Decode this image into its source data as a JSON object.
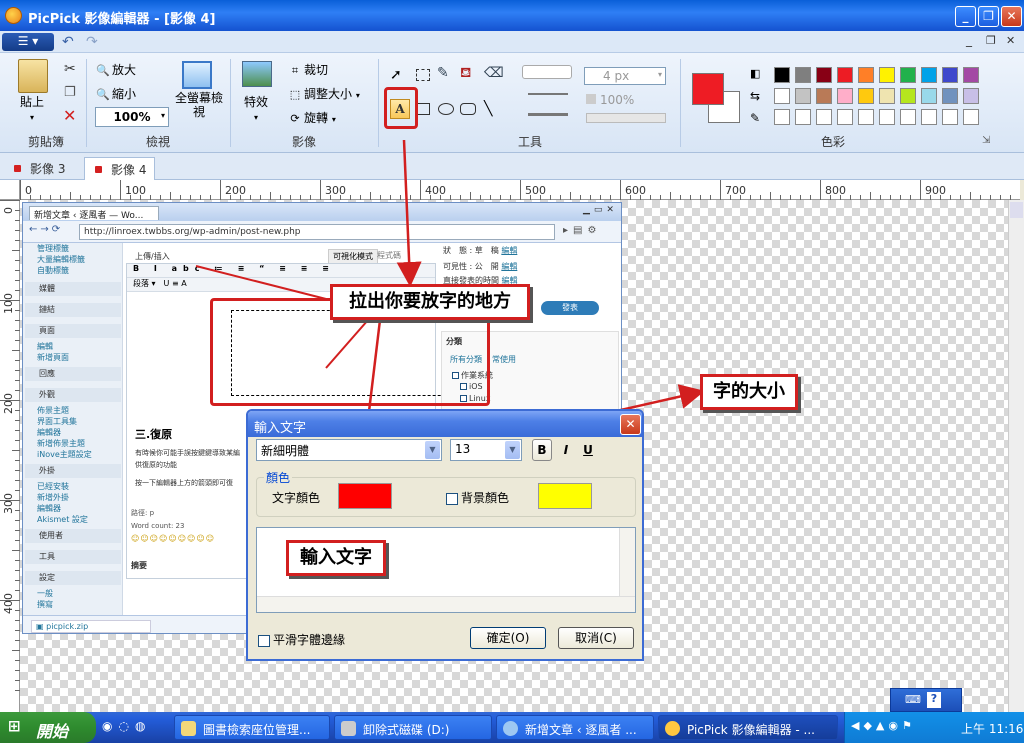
{
  "window": {
    "title": "PicPick 影像編輯器 - [影像 4]"
  },
  "ribbon": {
    "clipboard": {
      "paste": "貼上",
      "label": "剪貼簿"
    },
    "view": {
      "zoom_in": "放大",
      "zoom_out": "縮小",
      "zoom_value": "100%",
      "fullscreen": "全螢幕檢視",
      "label": "檢視"
    },
    "image": {
      "effects": "特效",
      "crop": "裁切",
      "resize": "調整大小",
      "rotate": "旋轉",
      "label": "影像"
    },
    "tools": {
      "label": "工具",
      "text_tool_letter": "A",
      "line_width": "4 px",
      "opacity": "100%"
    },
    "colors": {
      "label": "色彩",
      "primary": "#ee1c24",
      "secondary": "#ffffff",
      "palette_row1": [
        "#000000",
        "#7f7f7f",
        "#880015",
        "#ed1c24",
        "#ff7f27",
        "#fff200",
        "#22b14c",
        "#00a2e8",
        "#3f48cc",
        "#a349a4"
      ],
      "palette_row2": [
        "#ffffff",
        "#c3c3c3",
        "#b97a57",
        "#ffaec9",
        "#ffc90e",
        "#efe4b0",
        "#b5e61d",
        "#99d9ea",
        "#7092be",
        "#c8bfe7"
      ]
    }
  },
  "tabs": [
    {
      "label": "影像 3"
    },
    {
      "label": "影像 4"
    }
  ],
  "ruler": {
    "h": [
      "0",
      "100",
      "200",
      "300",
      "400",
      "500",
      "600",
      "700",
      "800",
      "900"
    ],
    "v": [
      "0",
      "100",
      "200",
      "300",
      "400"
    ]
  },
  "screenshot": {
    "browser_tab": "新增文章 ‹ 逐風者 — Wo...",
    "url": "http://linroex.twbbs.org/wp-admin/post-new.php",
    "upload": "上傳/插入",
    "visual_tab": "可視化模式",
    "html_tab": "程式碼",
    "format": "段落",
    "side_top": [
      "管理標籤",
      "大量編輯標籤",
      "自動標籤"
    ],
    "side_sections": [
      {
        "head": "媒體",
        "items": []
      },
      {
        "head": "鏈結",
        "items": []
      },
      {
        "head": "頁面",
        "items": [
          "編輯",
          "新增頁面"
        ]
      },
      {
        "head": "回應",
        "items": []
      },
      {
        "head": "外觀",
        "items": [
          "佈景主題",
          "界面工具集",
          "編輯器",
          "新增佈景主題",
          "iNove主題設定"
        ]
      },
      {
        "head": "外掛",
        "items": [
          "已經安裝",
          "新增外掛",
          "編輯器",
          "Akismet 設定"
        ]
      },
      {
        "head": "使用者",
        "items": []
      },
      {
        "head": "工具",
        "items": []
      },
      {
        "head": "設定",
        "items": [
          "一般",
          "撰寫"
        ]
      }
    ],
    "heading": "三.復原",
    "para1": "有時候你可能手誤按鍵鍵導致某編",
    "para2": "供復原的功能",
    "para3": "按一下編輯器上方的箭頭即可復",
    "path": "路徑: p",
    "word_count": "Word count: 23",
    "meta_status": "狀　態 : 草　稿",
    "meta_visibility": "可見性 : 公　開",
    "meta_publish": "直接發表的時間",
    "edit": "編輯",
    "publish": "發表",
    "cat_head": "分類",
    "cat_all": "所有分類",
    "cat_used": "常使用",
    "cat_items": [
      "作業系統",
      "iOS",
      "Linux"
    ],
    "excerpt": "摘要",
    "download": "picpick.zip"
  },
  "callouts": {
    "drag": "拉出你要放字的地方",
    "size": "字的大小",
    "input": "輸入文字"
  },
  "dialog": {
    "title": "輸入文字",
    "font": "新細明體",
    "size": "13",
    "bold": "B",
    "italic": "I",
    "underline": "U",
    "color_group": "顏色",
    "text_color_label": "文字顏色",
    "text_color": "#ff0000",
    "bg_color_label": "背景顏色",
    "bg_color": "#ffff00",
    "antialias": "平滑字體邊緣",
    "ok": "確定(O)",
    "cancel": "取消(C)"
  },
  "taskbar": {
    "start": "開始",
    "tasks": [
      "圖書檢索座位管理...",
      "卸除式磁碟 (D:)",
      "新增文章 ‹ 逐風者 ...",
      "PicPick 影像編輯器 - ..."
    ],
    "clock": "上午 11:16"
  }
}
